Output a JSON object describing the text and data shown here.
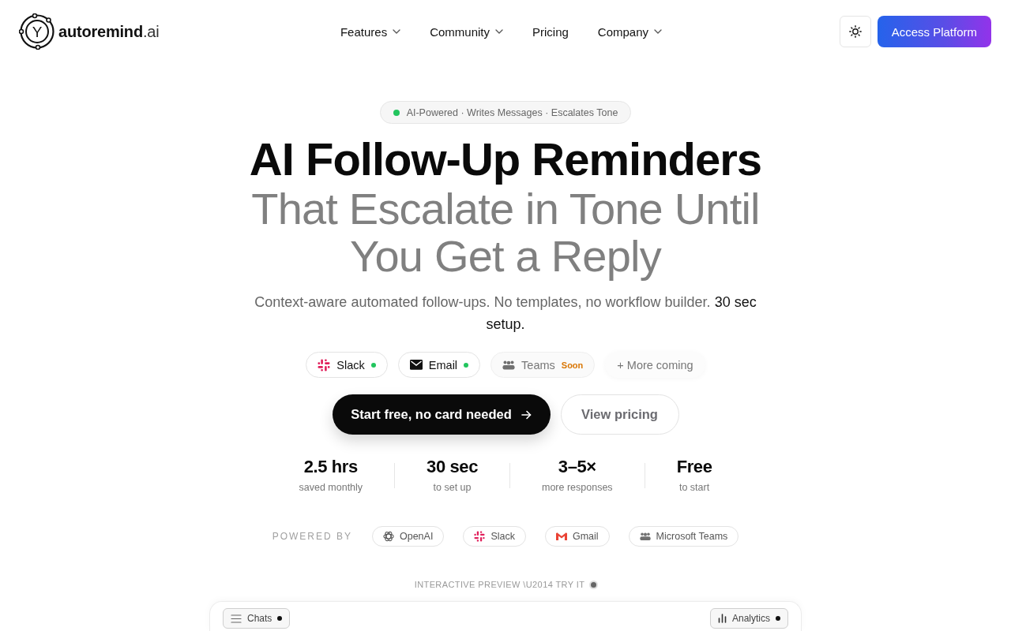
{
  "brand": {
    "mark": "Y",
    "name": "autoremind",
    "suffix": ".ai"
  },
  "nav": [
    {
      "label": "Features",
      "dropdown": true
    },
    {
      "label": "Community",
      "dropdown": true
    },
    {
      "label": "Pricing",
      "dropdown": false
    },
    {
      "label": "Company",
      "dropdown": true
    }
  ],
  "header_cta": "Access Platform",
  "hero": {
    "badge": "AI-Powered · Writes Messages · Escalates Tone",
    "title": "AI Follow-Up Reminders",
    "title_continuation": "That Escalate in Tone Until You Get a Reply",
    "subtitle": "Context-aware automated follow-ups. No templates, no workflow builder. **30 sec setup.**"
  },
  "channels": [
    {
      "kind": "slack",
      "label": "Slack",
      "available": true
    },
    {
      "kind": "email",
      "label": "Email",
      "available": true
    },
    {
      "kind": "teams",
      "label": "Teams",
      "available": false,
      "note": "Soon"
    },
    {
      "kind": "more",
      "label": "+ More coming",
      "available": false
    }
  ],
  "actions": {
    "primary": "Start free, no card needed",
    "secondary": "View pricing"
  },
  "stats": [
    {
      "value": "2.5 hrs",
      "caption": "saved monthly"
    },
    {
      "value": "30 sec",
      "caption": "to set up"
    },
    {
      "value": "3–5×",
      "caption": "more responses"
    },
    {
      "value": "Free",
      "caption": "to start"
    }
  ],
  "powered_by": {
    "label": "POWERED BY",
    "partners": [
      {
        "kind": "openai",
        "name": "OpenAI"
      },
      {
        "kind": "slack",
        "name": "Slack"
      },
      {
        "kind": "gmail",
        "name": "Gmail"
      },
      {
        "kind": "teams",
        "name": "Microsoft Teams"
      }
    ]
  },
  "preview": {
    "label": "INTERACTIVE PREVIEW \\U2014 TRY IT",
    "tabs": [
      {
        "kind": "chats",
        "label": "Chats",
        "indicator": true
      },
      {
        "kind": "analytics",
        "label": "Analytics",
        "indicator": true
      }
    ]
  }
}
